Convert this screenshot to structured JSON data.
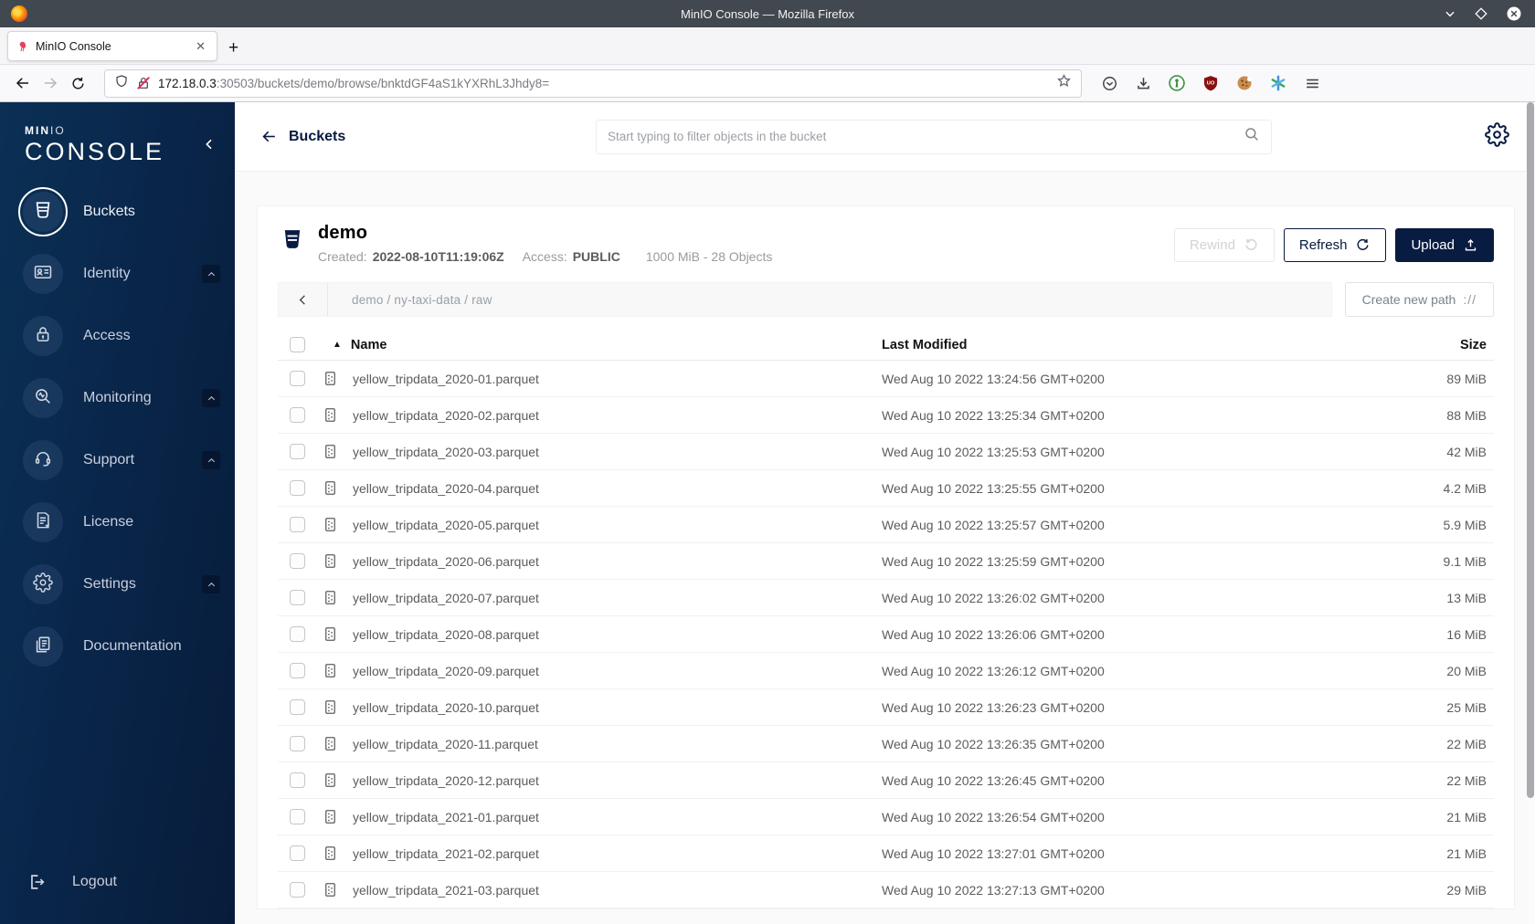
{
  "window": {
    "title": "MinIO Console — Mozilla Firefox"
  },
  "browser": {
    "tab": {
      "title": "MinIO Console",
      "close_glyph": "✕"
    },
    "new_tab_glyph": "+",
    "url": {
      "host": "172.18.0.3",
      "rest": ":30503/buckets/demo/browse/bnktdGF4aS1kYXRhL3Jhdy8="
    },
    "toolbar_icons": [
      "shield-icon",
      "lock-insecure-icon",
      "bookmark-star-icon",
      "pocket-icon",
      "download-icon",
      "extension-green-icon",
      "ublock-shield-icon",
      "cookie-icon",
      "asterisk-extension-icon",
      "menu-hamburger-icon"
    ],
    "ublock_badge": "UO"
  },
  "sidebar": {
    "logo_top": "MIN",
    "logo_top_thin": "IO",
    "logo_bottom": "CONSOLE",
    "items": [
      {
        "label": "Buckets",
        "icon": "buckets-icon",
        "selected": true,
        "chevron": false
      },
      {
        "label": "Identity",
        "icon": "identity-icon",
        "selected": false,
        "chevron": true
      },
      {
        "label": "Access",
        "icon": "access-icon",
        "selected": false,
        "chevron": false
      },
      {
        "label": "Monitoring",
        "icon": "monitoring-icon",
        "selected": false,
        "chevron": true
      },
      {
        "label": "Support",
        "icon": "support-icon",
        "selected": false,
        "chevron": true
      },
      {
        "label": "License",
        "icon": "license-icon",
        "selected": false,
        "chevron": false
      },
      {
        "label": "Settings",
        "icon": "settings-icon",
        "selected": false,
        "chevron": true
      },
      {
        "label": "Documentation",
        "icon": "documentation-icon",
        "selected": false,
        "chevron": false
      }
    ],
    "logout": {
      "label": "Logout",
      "icon": "logout-icon"
    }
  },
  "header": {
    "back_label": "Buckets",
    "search_placeholder": "Start typing to filter objects in the bucket"
  },
  "bucket": {
    "name": "demo",
    "created_label": "Created:",
    "created_value": "2022-08-10T11:19:06Z",
    "access_label": "Access:",
    "access_value": "PUBLIC",
    "summary": "1000 MiB - 28 Objects",
    "actions": {
      "rewind": "Rewind",
      "refresh": "Refresh",
      "upload": "Upload"
    }
  },
  "browse": {
    "path": "demo / ny-taxi-data / raw",
    "create_new_path": "Create new path",
    "create_new_path_glyph": "://"
  },
  "table": {
    "columns": {
      "name": "Name",
      "modified": "Last Modified",
      "size": "Size"
    },
    "sort_glyph": "▲",
    "rows": [
      {
        "name": "yellow_tripdata_2020-01.parquet",
        "modified": "Wed Aug 10 2022 13:24:56 GMT+0200",
        "size": "89 MiB"
      },
      {
        "name": "yellow_tripdata_2020-02.parquet",
        "modified": "Wed Aug 10 2022 13:25:34 GMT+0200",
        "size": "88 MiB"
      },
      {
        "name": "yellow_tripdata_2020-03.parquet",
        "modified": "Wed Aug 10 2022 13:25:53 GMT+0200",
        "size": "42 MiB"
      },
      {
        "name": "yellow_tripdata_2020-04.parquet",
        "modified": "Wed Aug 10 2022 13:25:55 GMT+0200",
        "size": "4.2 MiB"
      },
      {
        "name": "yellow_tripdata_2020-05.parquet",
        "modified": "Wed Aug 10 2022 13:25:57 GMT+0200",
        "size": "5.9 MiB"
      },
      {
        "name": "yellow_tripdata_2020-06.parquet",
        "modified": "Wed Aug 10 2022 13:25:59 GMT+0200",
        "size": "9.1 MiB"
      },
      {
        "name": "yellow_tripdata_2020-07.parquet",
        "modified": "Wed Aug 10 2022 13:26:02 GMT+0200",
        "size": "13 MiB"
      },
      {
        "name": "yellow_tripdata_2020-08.parquet",
        "modified": "Wed Aug 10 2022 13:26:06 GMT+0200",
        "size": "16 MiB"
      },
      {
        "name": "yellow_tripdata_2020-09.parquet",
        "modified": "Wed Aug 10 2022 13:26:12 GMT+0200",
        "size": "20 MiB"
      },
      {
        "name": "yellow_tripdata_2020-10.parquet",
        "modified": "Wed Aug 10 2022 13:26:23 GMT+0200",
        "size": "25 MiB"
      },
      {
        "name": "yellow_tripdata_2020-11.parquet",
        "modified": "Wed Aug 10 2022 13:26:35 GMT+0200",
        "size": "22 MiB"
      },
      {
        "name": "yellow_tripdata_2020-12.parquet",
        "modified": "Wed Aug 10 2022 13:26:45 GMT+0200",
        "size": "22 MiB"
      },
      {
        "name": "yellow_tripdata_2021-01.parquet",
        "modified": "Wed Aug 10 2022 13:26:54 GMT+0200",
        "size": "21 MiB"
      },
      {
        "name": "yellow_tripdata_2021-02.parquet",
        "modified": "Wed Aug 10 2022 13:27:01 GMT+0200",
        "size": "21 MiB"
      },
      {
        "name": "yellow_tripdata_2021-03.parquet",
        "modified": "Wed Aug 10 2022 13:27:13 GMT+0200",
        "size": "29 MiB"
      }
    ]
  },
  "colors": {
    "accent_navy": "#081C42",
    "sidebar_gradient_start": "#0b3055",
    "sidebar_gradient_end": "#081c3a",
    "titlebar": "#42484f",
    "insecure_slash": "#e22850",
    "disabled_text": "#d3d3d3"
  }
}
